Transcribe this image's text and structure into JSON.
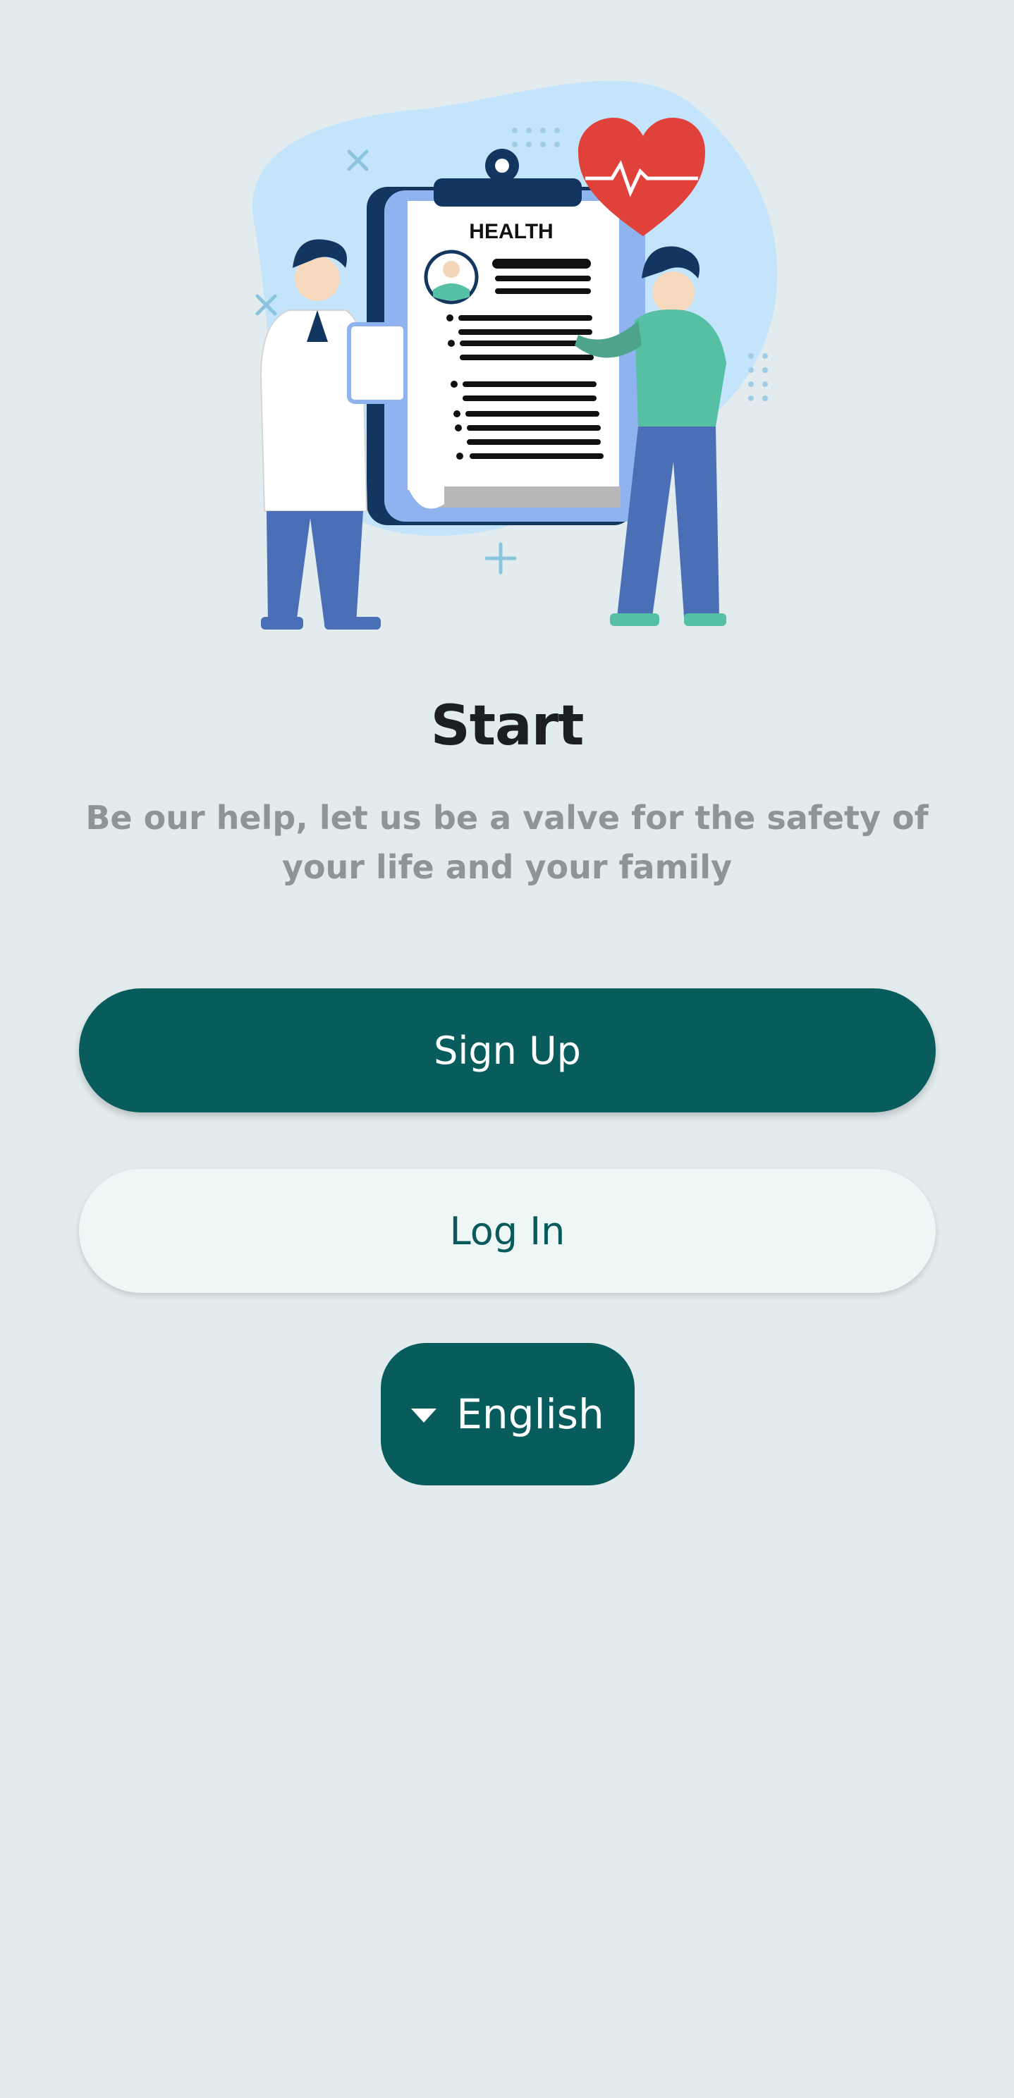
{
  "illustration": {
    "clipboard_heading": "HEALTH",
    "icons": [
      "doctor-figure",
      "patient-figure",
      "heart-icon",
      "clipboard-icon"
    ]
  },
  "title": "Start",
  "subtitle": "Be our help, let us be a valve for the safety of your life and your family",
  "buttons": {
    "sign_up": "Sign Up",
    "log_in": "Log In"
  },
  "language": {
    "selected": "English",
    "icon": "caret-down-icon"
  },
  "colors": {
    "background": "#e2ebee",
    "primary": "#085c5c",
    "secondary_button": "#eef6f6",
    "subtitle_text": "#8e9497"
  }
}
